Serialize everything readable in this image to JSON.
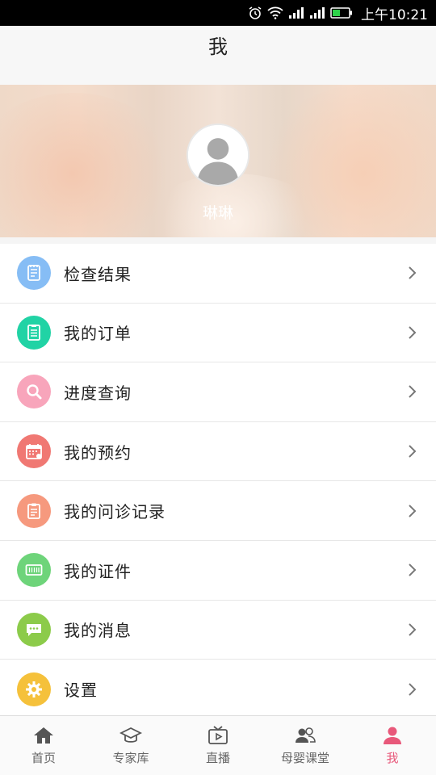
{
  "status_bar": {
    "time": "上午10:21"
  },
  "header": {
    "title": "我"
  },
  "profile": {
    "username": "琳琳"
  },
  "menu": [
    {
      "label": "检查结果",
      "icon": "report-icon",
      "color": "#86bdf5"
    },
    {
      "label": "我的订单",
      "icon": "order-icon",
      "color": "#21d3a5"
    },
    {
      "label": "进度查询",
      "icon": "search-icon",
      "color": "#f8a5bb"
    },
    {
      "label": "我的预约",
      "icon": "calendar-icon",
      "color": "#f07873"
    },
    {
      "label": "我的问诊记录",
      "icon": "clipboard-icon",
      "color": "#f6997e"
    },
    {
      "label": "我的证件",
      "icon": "id-card-icon",
      "color": "#6ed47a"
    },
    {
      "label": "我的消息",
      "icon": "message-icon",
      "color": "#8ccb4a"
    },
    {
      "label": "设置",
      "icon": "gear-icon",
      "color": "#f5c13b"
    }
  ],
  "tabs": [
    {
      "label": "首页",
      "icon": "home-icon"
    },
    {
      "label": "专家库",
      "icon": "graduation-cap-icon"
    },
    {
      "label": "直播",
      "icon": "tv-play-icon"
    },
    {
      "label": "母婴课堂",
      "icon": "group-icon"
    },
    {
      "label": "我",
      "icon": "person-icon",
      "active": true
    }
  ],
  "colors": {
    "accent": "#e8587a",
    "status_bar": "#000000"
  }
}
